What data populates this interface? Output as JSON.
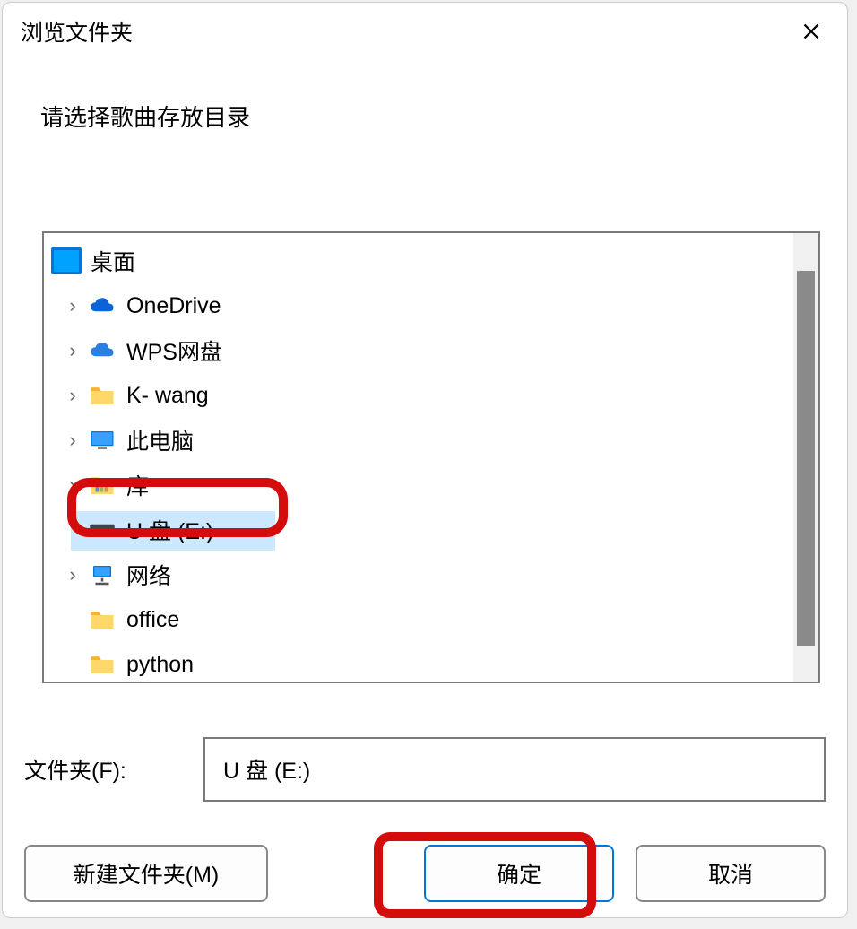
{
  "title": "浏览文件夹",
  "prompt": "请选择歌曲存放目录",
  "tree": {
    "root": "桌面",
    "items": [
      {
        "label": "OneDrive",
        "icon": "cloud-blue",
        "expandable": true
      },
      {
        "label": "WPS网盘",
        "icon": "cloud-blue",
        "expandable": true
      },
      {
        "label": "K- wang",
        "icon": "folder",
        "expandable": true
      },
      {
        "label": "此电脑",
        "icon": "pc",
        "expandable": true
      },
      {
        "label": "库",
        "icon": "folder-lib",
        "expandable": true
      },
      {
        "label": "U 盘 (E:)",
        "icon": "drive",
        "expandable": false,
        "selected": true
      },
      {
        "label": "网络",
        "icon": "network",
        "expandable": true
      },
      {
        "label": "office",
        "icon": "folder",
        "expandable": false
      },
      {
        "label": "python",
        "icon": "folder",
        "expandable": false
      }
    ]
  },
  "folder_field": {
    "label": "文件夹(F):",
    "value": "U 盘 (E:)"
  },
  "buttons": {
    "new_folder": "新建文件夹(M)",
    "ok": "确定",
    "cancel": "取消"
  }
}
